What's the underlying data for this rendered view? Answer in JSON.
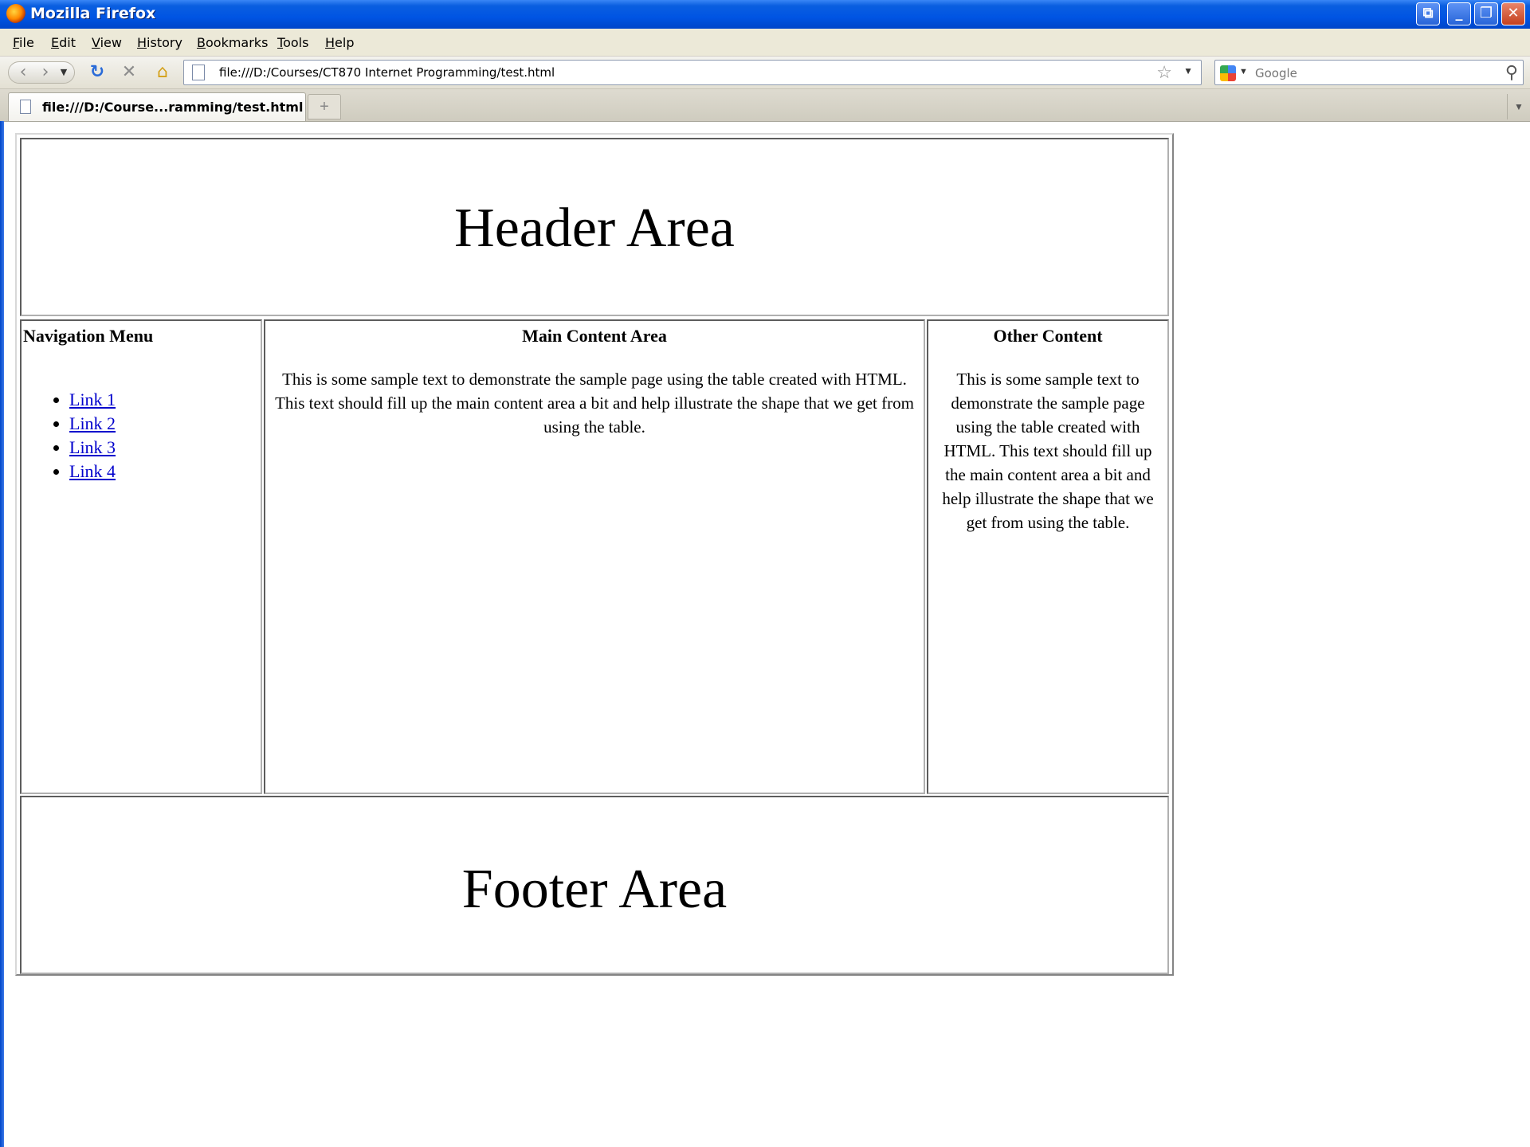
{
  "window": {
    "title": "Mozilla Firefox",
    "controls": [
      "_",
      "❐",
      "✕"
    ]
  },
  "menubar": {
    "items": [
      "File",
      "Edit",
      "View",
      "History",
      "Bookmarks",
      "Tools",
      "Help"
    ]
  },
  "toolbar": {
    "url": "file:///D:/Courses/CT870 Internet Programming/test.html",
    "search_placeholder": "Google"
  },
  "tabs": {
    "active_label": "file:///D:/Course...ramming/test.html",
    "new_tab": "+"
  },
  "page": {
    "header": "Header Area",
    "footer": "Footer Area",
    "nav": {
      "heading": "Navigation Menu",
      "links": [
        "Link 1",
        "Link 2",
        "Link 3",
        "Link 4"
      ]
    },
    "main": {
      "heading": "Main Content Area",
      "text": "This is some sample text to demonstrate the sample page using the table created with HTML. This text should fill up the main content area a bit and help illustrate the shape that we get from using the table."
    },
    "other": {
      "heading": "Other Content",
      "text": "This is some sample text to demonstrate the sample page using the table created with HTML. This text should fill up the main content area a bit and help illustrate the shape that we get from using the table."
    }
  }
}
